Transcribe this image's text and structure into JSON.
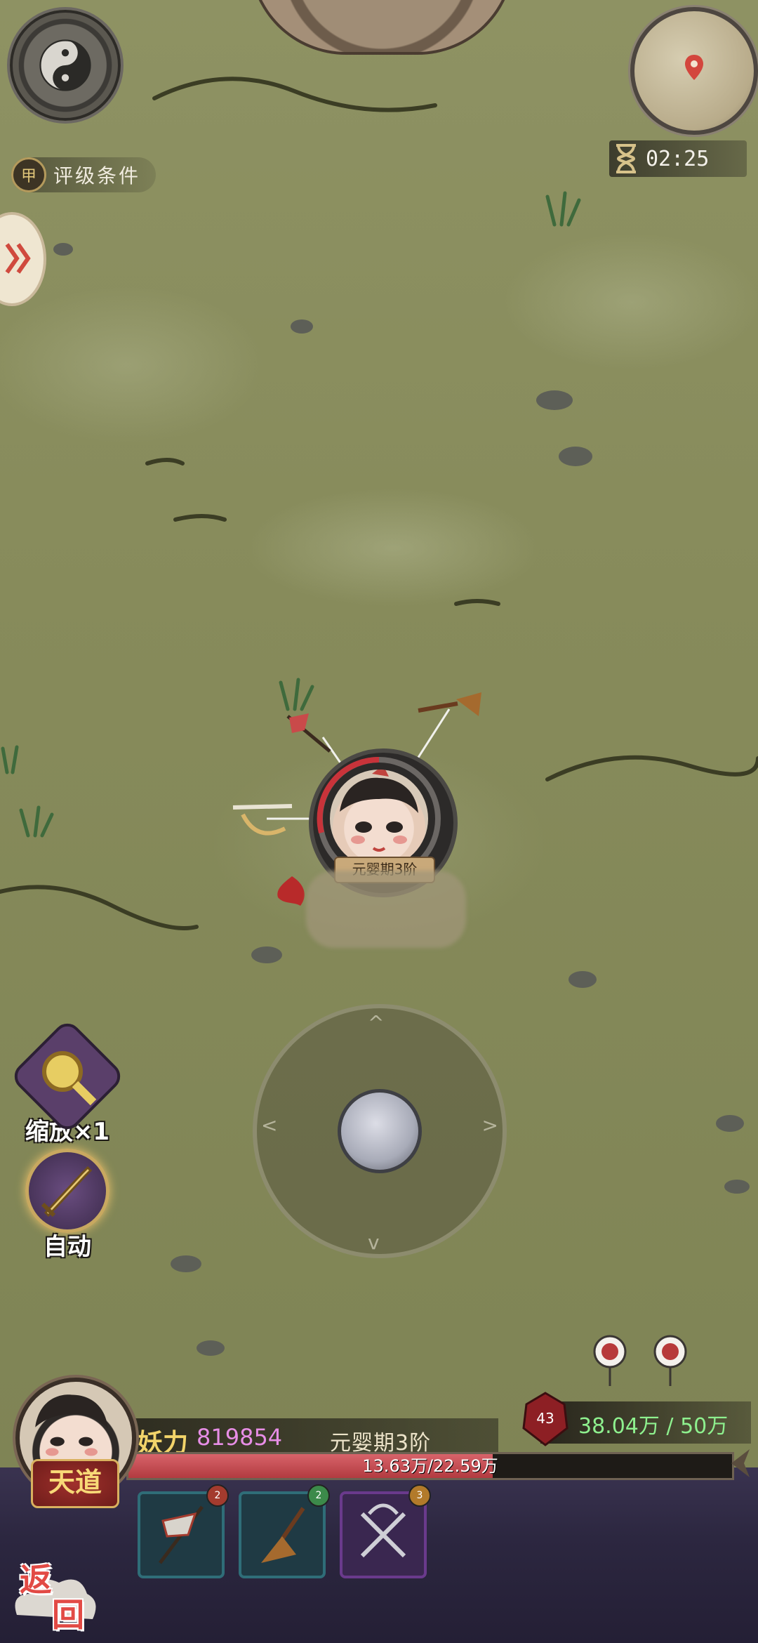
{
  "header": {
    "rating_badge": "甲",
    "rating_label": "评级条件",
    "timer": "02:25"
  },
  "player": {
    "rank_label": "元婴期3阶"
  },
  "controls": {
    "zoom_label": "缩放×1",
    "auto_label": "自动"
  },
  "hud": {
    "avatar_title": "天道",
    "power_label": "妖力",
    "power_value": "819854",
    "realm": "元婴期3阶",
    "hp_text": "13.63万/22.59万",
    "hp_fraction": 0.603,
    "kill_count": "43",
    "kill_progress": "38.04万 / 50万",
    "back_label_1": "返",
    "back_label_2": "回"
  },
  "skills": [
    {
      "name": "flag-weapon",
      "badge": "2",
      "badge_color": "#a33b2e",
      "border": "#2f6d78"
    },
    {
      "name": "whisk-weapon",
      "badge": "2",
      "badge_color": "#3c8a4a",
      "border": "#2f6d78"
    },
    {
      "name": "twin-hooks-weapon",
      "badge": "3",
      "badge_color": "#b27a2a",
      "border": "#6a3a8c"
    }
  ],
  "colors": {
    "map_bg": "#878b5b",
    "power_value": "#e78ee6",
    "kill_progress": "#8ef08e",
    "hp_fill": "#b23b40"
  }
}
